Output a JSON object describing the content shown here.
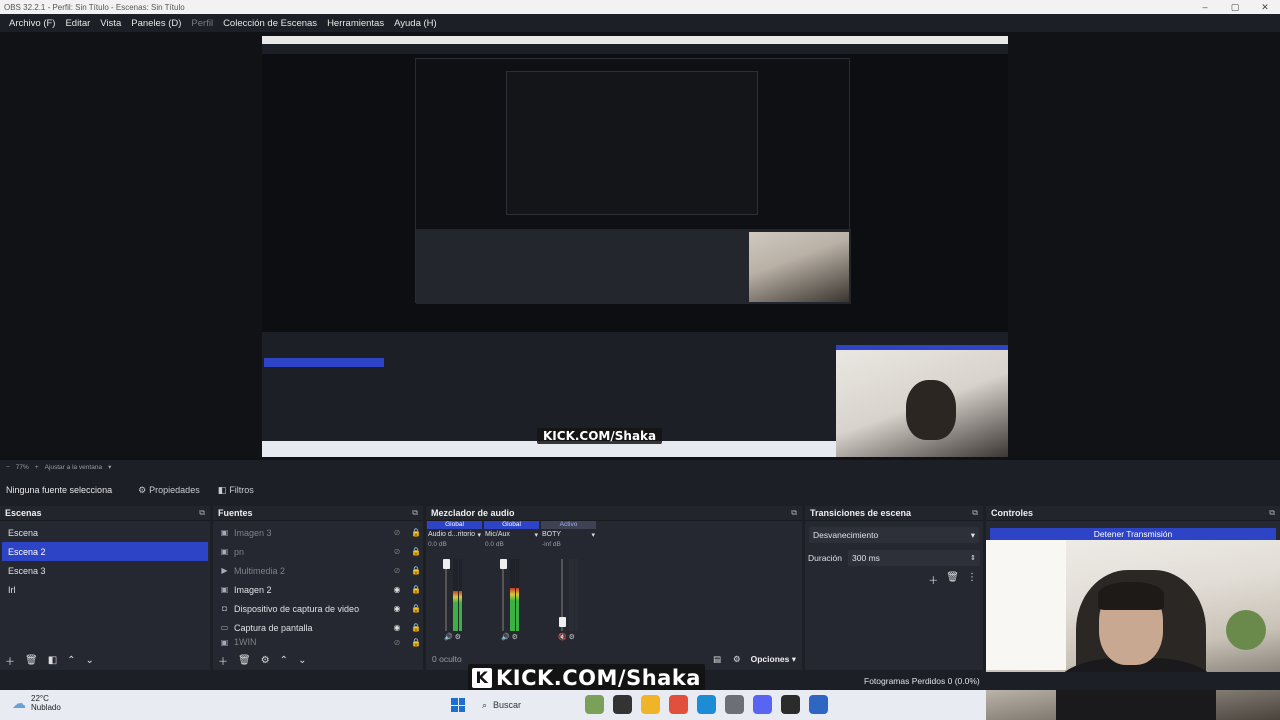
{
  "window": {
    "title": "OBS 32.2.1 - Perfil: Sin Título - Escenas: Sin Título"
  },
  "menu": [
    {
      "label": "Archivo (F)",
      "dim": false
    },
    {
      "label": "Editar",
      "dim": false
    },
    {
      "label": "Vista",
      "dim": false
    },
    {
      "label": "Paneles (D)",
      "dim": false
    },
    {
      "label": "Perfil",
      "dim": true
    },
    {
      "label": "Colección de Escenas",
      "dim": false
    },
    {
      "label": "Herramientas",
      "dim": false
    },
    {
      "label": "Ayuda (H)",
      "dim": false
    }
  ],
  "zoom": {
    "minus": "−",
    "value": "77%",
    "plus": "+",
    "fit": "Ajustar a la ventana"
  },
  "context": {
    "none_selected": "Ninguna fuente selecciona",
    "properties": "Propiedades",
    "filters": "Filtros"
  },
  "scenes": {
    "title": "Escenas",
    "items": [
      {
        "label": "Escena",
        "selected": false
      },
      {
        "label": "Escena 2",
        "selected": true
      },
      {
        "label": "Escena 3",
        "selected": false
      },
      {
        "label": "Irl",
        "selected": false
      }
    ]
  },
  "sources": {
    "title": "Fuentes",
    "items": [
      {
        "label": "Imagen 3",
        "icon": "image-icon",
        "visible": false
      },
      {
        "label": "pn",
        "icon": "image-icon",
        "visible": false
      },
      {
        "label": "Multimedia 2",
        "icon": "play-icon",
        "visible": false
      },
      {
        "label": "Imagen 2",
        "icon": "image-icon",
        "visible": true
      },
      {
        "label": "Dispositivo de captura de video",
        "icon": "camera-icon",
        "visible": true
      },
      {
        "label": "Captura de pantalla",
        "icon": "monitor-icon",
        "visible": true
      },
      {
        "label": "1WIN",
        "icon": "image-icon",
        "visible": false
      }
    ]
  },
  "mixer": {
    "title": "Mezclador de audio",
    "channels": [
      {
        "tag": "Global",
        "name": "Audio d...ritorio",
        "db": "0.0 dB",
        "active": false,
        "level": 0.55
      },
      {
        "tag": "Global",
        "name": "Mic/Aux",
        "db": "0.0 dB",
        "active": false,
        "level": 0.6
      },
      {
        "tag": "Activo",
        "name": "BOTY",
        "db": "-inf dB",
        "active": true,
        "level": 0.0
      }
    ],
    "ticks": [
      "0",
      "-5",
      "-10",
      "-15",
      "-20",
      "-25",
      "-30",
      "-35",
      "-40",
      "-45",
      "-50",
      "-55",
      "-60"
    ],
    "hidden": "0 oculto",
    "options": "Opciones"
  },
  "transitions": {
    "title": "Transiciones de escena",
    "selected": "Desvanecimiento",
    "duration_label": "Duración",
    "duration_value": "300 ms"
  },
  "controls": {
    "title": "Controles",
    "stop_stream": "Detener Transmisión"
  },
  "status": {
    "dropped_frames": "Fotogramas Perdidos 0 (0.0%)"
  },
  "watermark": {
    "text": "KICK.COM/Shaka"
  },
  "taskbar": {
    "weather_temp": "22°C",
    "weather_desc": "Nublado",
    "search": "Buscar",
    "icons": [
      {
        "name": "widgets-icon",
        "color": "#7aa05a"
      },
      {
        "name": "taskview-icon",
        "color": "#333333"
      },
      {
        "name": "folder-icon",
        "color": "#f0b429"
      },
      {
        "name": "store-icon",
        "color": "#e0503d"
      },
      {
        "name": "edge-icon",
        "color": "#1c8cd6"
      },
      {
        "name": "settings-icon",
        "color": "#6b6f78"
      },
      {
        "name": "discord-icon",
        "color": "#5865f2"
      },
      {
        "name": "obs-icon",
        "color": "#2b2b2b"
      },
      {
        "name": "app-icon",
        "color": "#2f66c4"
      }
    ]
  },
  "colors": {
    "accent": "#2d44c7",
    "dock_bg": "#262831",
    "bg": "#1d1f26"
  }
}
